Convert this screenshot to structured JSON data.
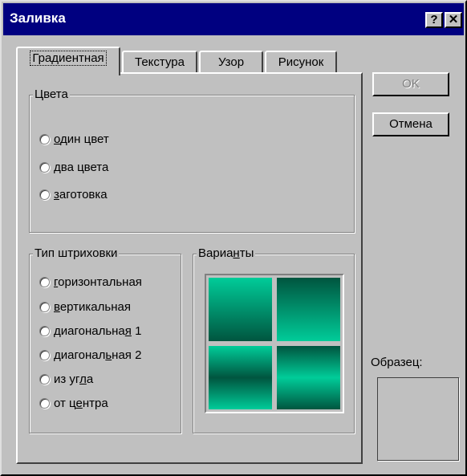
{
  "window": {
    "title": "Заливка",
    "help_glyph": "?",
    "close_glyph": "✕"
  },
  "tabs": [
    {
      "label": "Градиентная",
      "active": true
    },
    {
      "label": "Текстура",
      "active": false
    },
    {
      "label": "Узор",
      "active": false
    },
    {
      "label": "Рисунок",
      "active": false
    }
  ],
  "colors_group": {
    "label": "Цвета",
    "options": [
      {
        "label": "один цвет",
        "hotkey_index": 0
      },
      {
        "label": "два цвета",
        "hotkey_index": 0
      },
      {
        "label": "заготовка",
        "hotkey_index": 0
      }
    ]
  },
  "shading_group": {
    "label": "Тип штриховки",
    "options": [
      {
        "label": "горизонтальная",
        "hotkey_index": 0
      },
      {
        "label": "вертикальная",
        "hotkey_index": 0
      },
      {
        "label": "диагональная 1",
        "hotkey_index": 11
      },
      {
        "label": "диагональная 2",
        "hotkey_index": 8
      },
      {
        "label": "из угла",
        "hotkey_index": 5
      },
      {
        "label": "от центра",
        "hotkey_index": 4
      }
    ]
  },
  "variants_group": {
    "label": "Варианты",
    "hotkey_index": 5,
    "gradient_light": "#00cc99",
    "gradient_dark": "#00553f"
  },
  "buttons": {
    "ok": "OK",
    "cancel": "Отмена"
  },
  "sample": {
    "label": "Образец:"
  },
  "colors": {
    "titlebar": "#000080",
    "face": "#c0c0c0"
  }
}
